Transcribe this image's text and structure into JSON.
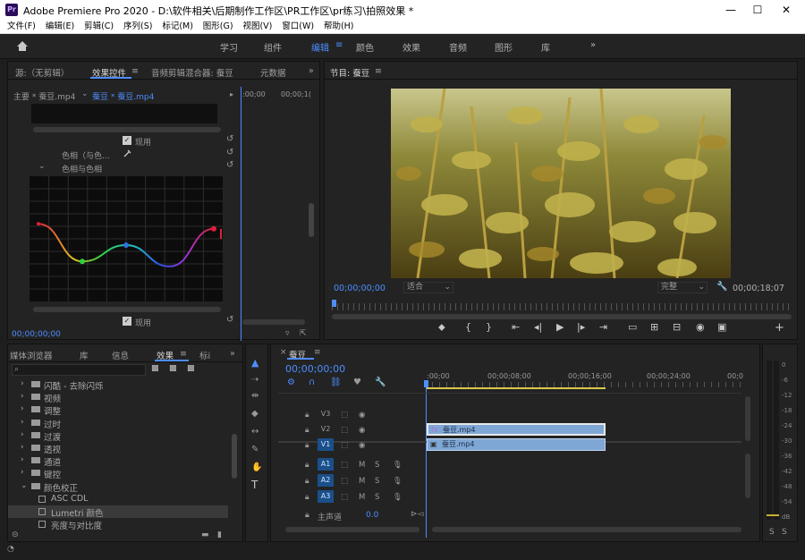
{
  "window": {
    "title": "Adobe Premiere Pro 2020 - D:\\软件相关\\后期制作工作区\\PR工作区\\pr练习\\拍照效果 *",
    "app_icon": "Pr"
  },
  "menu": [
    "文件(F)",
    "编辑(E)",
    "剪辑(C)",
    "序列(S)",
    "标记(M)",
    "图形(G)",
    "视图(V)",
    "窗口(W)",
    "帮助(H)"
  ],
  "workspaces": [
    "学习",
    "组件",
    "编辑",
    "颜色",
    "效果",
    "音频",
    "图形",
    "库"
  ],
  "active_workspace": "编辑",
  "source_panel": {
    "tabs": [
      "源:（无剪辑）",
      "效果控件",
      "音频剪辑混合器: 蚕豆",
      "元数据"
    ],
    "active_tab": "效果控件",
    "clip_path": "主要 * 蚕豆.mp4",
    "clip_active": "蚕豆 * 蚕豆.mp4",
    "ruler_labels": [
      ":00;00",
      "00;00;1("
    ],
    "rows": [
      "现用",
      "色相（与色...",
      "色相与色相",
      "现用"
    ],
    "timecode": "00;00;00;00"
  },
  "program_panel": {
    "title": "节目: 蚕豆",
    "timecode_left": "00;00;00;00",
    "fit": "适合",
    "quality": "完整",
    "timecode_right": "00;00;18;07"
  },
  "project_panel": {
    "tabs": [
      "媒体浏览器",
      "库",
      "信息",
      "效果",
      "标i"
    ],
    "active_tab": "效果",
    "items": [
      {
        "label": "闪酷 - 去除闪烁",
        "type": "folder"
      },
      {
        "label": "视频",
        "type": "folder"
      },
      {
        "label": "调整",
        "type": "folder"
      },
      {
        "label": "过时",
        "type": "folder"
      },
      {
        "label": "过渡",
        "type": "folder"
      },
      {
        "label": "透视",
        "type": "folder"
      },
      {
        "label": "通道",
        "type": "folder"
      },
      {
        "label": "键控",
        "type": "folder"
      },
      {
        "label": "颜色校正",
        "type": "folder-open"
      },
      {
        "label": "ASC CDL",
        "type": "effect"
      },
      {
        "label": "Lumetri 颜色",
        "type": "effect",
        "selected": true
      },
      {
        "label": "亮度与对比度",
        "type": "effect"
      }
    ]
  },
  "timeline": {
    "tab": "蚕豆",
    "timecode": "00;00;00;00",
    "ruler": [
      ":00;00",
      "00;00;08;00",
      "00;00;16;00",
      "00;00;24;00",
      "00;0"
    ],
    "tracks": [
      {
        "name": "V3",
        "type": "video"
      },
      {
        "name": "V2",
        "type": "video",
        "clip": "蚕豆.mp4",
        "fx": true
      },
      {
        "name": "V1",
        "type": "video",
        "clip": "蚕豆.mp4",
        "active": true
      },
      {
        "name": "A1",
        "type": "audio"
      },
      {
        "name": "A2",
        "type": "audio"
      },
      {
        "name": "A3",
        "type": "audio"
      }
    ],
    "master": "主声道",
    "master_value": "0.0"
  },
  "audio_meter": {
    "marks": [
      "0",
      "-6",
      "-12",
      "-18",
      "-24",
      "-30",
      "-36",
      "-42",
      "-48",
      "-54",
      "dB"
    ]
  },
  "chart_data": {
    "type": "line",
    "title": "色相与色相",
    "x": [
      0,
      1,
      2,
      3,
      4
    ],
    "values": [
      0.62,
      0.32,
      0.45,
      0.28,
      0.58
    ]
  },
  "colors": {
    "accent": "#4d8dff",
    "clip": "#7fa7d6",
    "track_active": "#1a4f8a"
  }
}
